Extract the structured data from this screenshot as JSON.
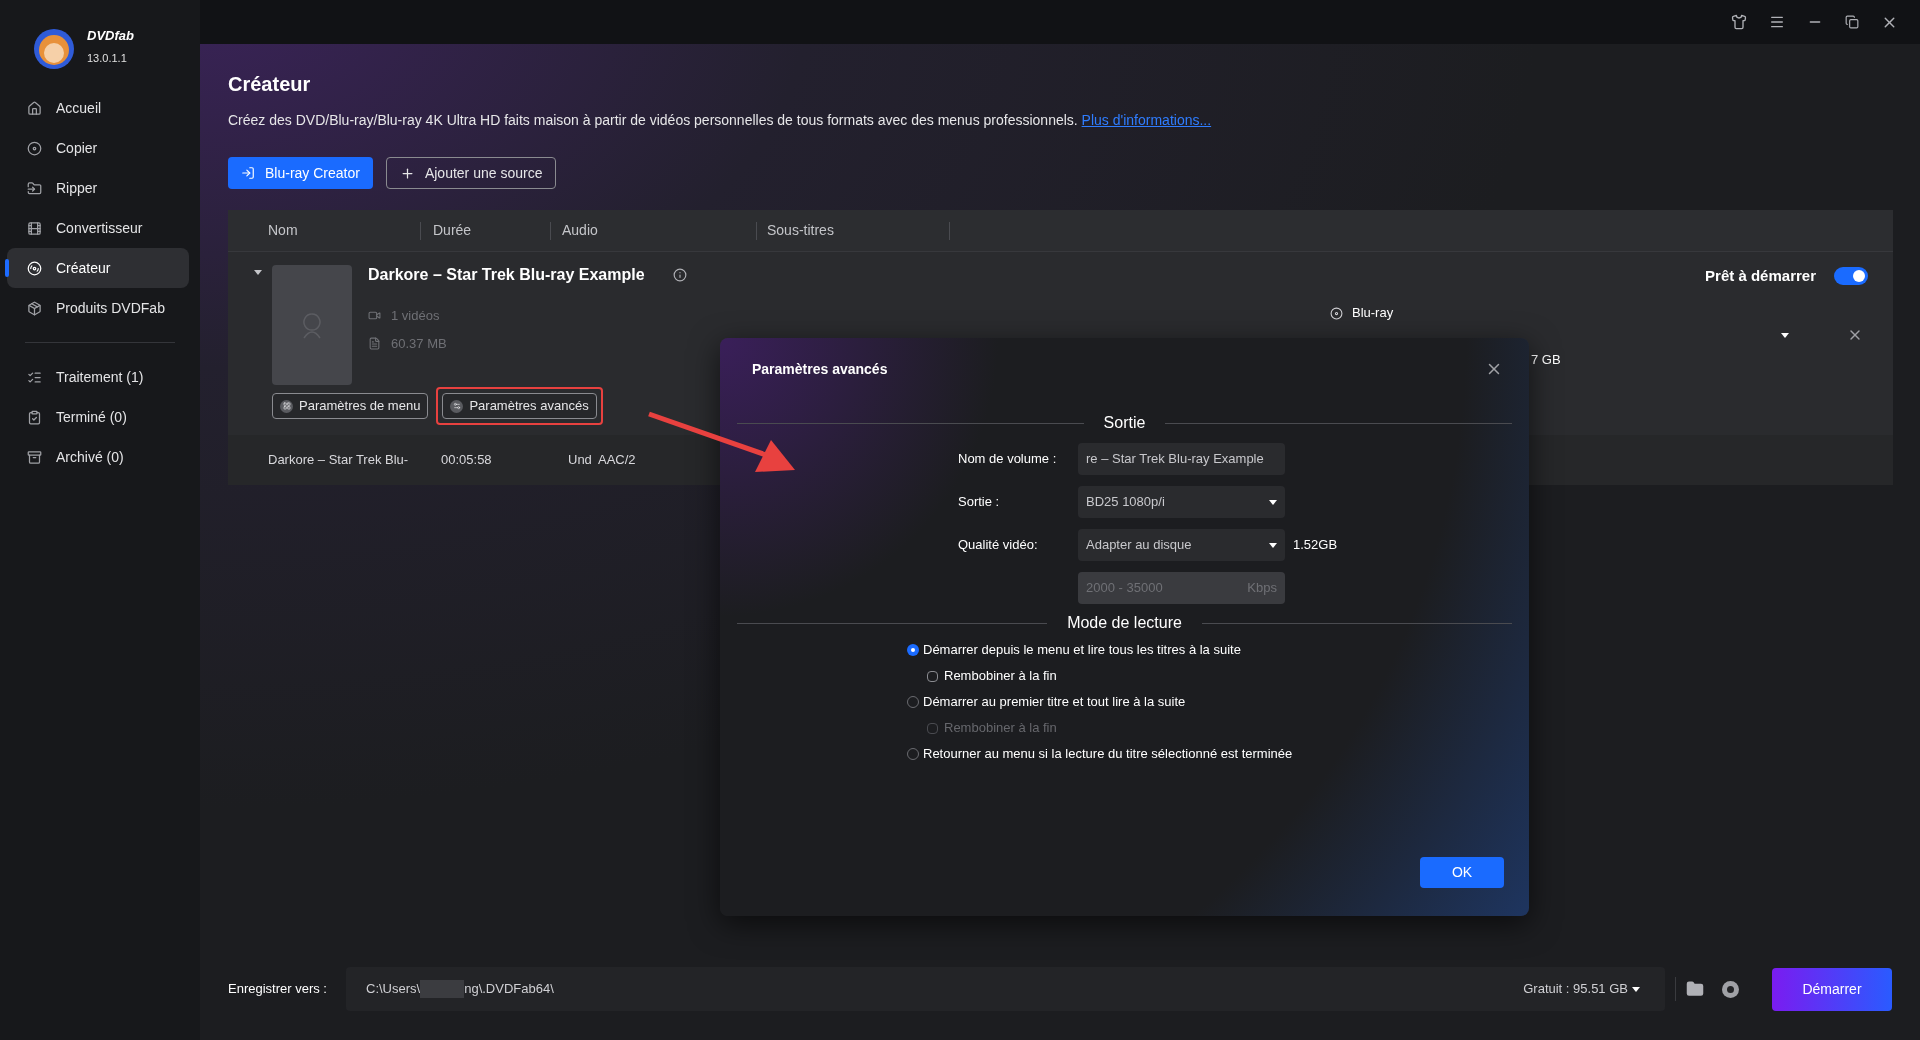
{
  "app": {
    "name": "DVDfab",
    "version": "13.0.1.1"
  },
  "sidebar": {
    "nav": [
      {
        "label": "Accueil",
        "selected": false
      },
      {
        "label": "Copier",
        "selected": false
      },
      {
        "label": "Ripper",
        "selected": false
      },
      {
        "label": "Convertisseur",
        "selected": false
      },
      {
        "label": "Créateur",
        "selected": true
      },
      {
        "label": "Produits DVDFab",
        "selected": false
      }
    ],
    "queue": [
      {
        "label": "Traitement (1)",
        "selected": false
      },
      {
        "label": "Terminé (0)",
        "selected": false
      },
      {
        "label": "Archivé (0)",
        "selected": false
      }
    ]
  },
  "page": {
    "title": "Créateur",
    "description": "Créez des DVD/Blu-ray/Blu-ray 4K Ultra HD faits maison à partir de vidéos personnelles de tous formats avec des menus professionnels.",
    "link": "Plus d'informations..."
  },
  "toolbar": [
    {
      "label": "Blu-ray Creator",
      "kind": "primary"
    },
    {
      "label": "Ajouter une source",
      "kind": "outline"
    }
  ],
  "table": {
    "columns": [
      "Nom",
      "Durée",
      "Audio",
      "Sous-titres"
    ],
    "item": {
      "expanded": true,
      "title": "Darkore – Star Trek Blu-ray Example",
      "videos": "1 vidéos",
      "size": "60.37 MB",
      "buttons": [
        {
          "label": "Paramètres de menu",
          "highlighted": false
        },
        {
          "label": "Paramètres avancés",
          "highlighted": true
        }
      ],
      "status": "Prêt à démarrer",
      "ready_on": true,
      "output": "Blu-ray",
      "output_size": "7 GB",
      "track": {
        "name": "Darkore – Star Trek Blu-",
        "duration": "00:05:58",
        "audio_lang": "Und",
        "audio_format": "AAC/2"
      }
    }
  },
  "dialog": {
    "title": "Paramètres avancés",
    "output_section": "Sortie",
    "fields": [
      {
        "kind": "text",
        "label": "Nom de volume :",
        "value": "re – Star Trek Blu-ray Example"
      },
      {
        "kind": "select",
        "label": "Sortie :",
        "value": "BD25 1080p/i"
      },
      {
        "kind": "select",
        "label": "Qualité vidéo:",
        "value": "Adapter au disque",
        "note": "1.52GB"
      },
      {
        "kind": "range",
        "placeholder": "2000 - 35000",
        "unit": "Kbps"
      }
    ],
    "playback_section": "Mode de lecture",
    "options": [
      {
        "kind": "radio",
        "label": "Démarrer depuis le menu et lire tous les titres à la suite",
        "selected": true
      },
      {
        "kind": "checkbox",
        "label": "Rembobiner à la fin",
        "checked": false,
        "disabled": false
      },
      {
        "kind": "radio",
        "label": "Démarrer au premier titre et tout lire à la suite",
        "selected": false
      },
      {
        "kind": "checkbox",
        "label": "Rembobiner à la fin",
        "checked": false,
        "disabled": true
      },
      {
        "kind": "radio",
        "label": "Retourner au menu si la lecture du titre sélectionné est terminée",
        "selected": false
      }
    ],
    "ok": "OK"
  },
  "footer": {
    "label": "Enregistrer vers :",
    "path_start": "C:\\Users\\",
    "path_end": "ng\\.DVDFab64\\",
    "free_space": "Gratuit : 95.51 GB",
    "start": "Démarrer"
  }
}
